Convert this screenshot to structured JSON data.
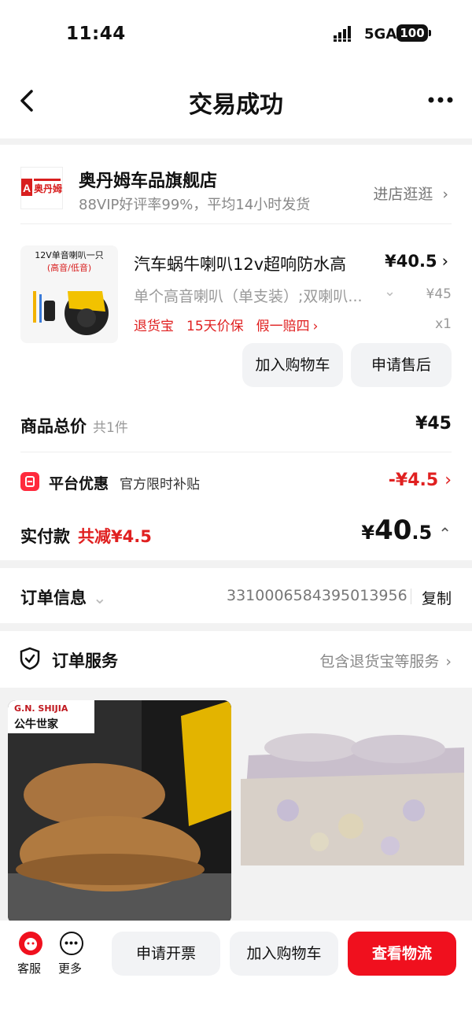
{
  "status": {
    "time": "11:44",
    "network": "5GA",
    "battery": "100"
  },
  "nav": {
    "title": "交易成功"
  },
  "shop": {
    "name": "奥丹姆车品旗舰店",
    "subtitle": "88VIP好评率99%，平均14小时发货",
    "enter_label": "进店逛逛",
    "logo_text": "奥丹姆"
  },
  "product": {
    "image_text_1": "12V单音喇叭一只",
    "image_text_2": "(高音/低音)",
    "title": "汽车蜗牛喇叭12v超响防水高",
    "price": "¥40.5",
    "spec": "单个高音喇叭（单支装）;双喇叭...",
    "original_price": "¥45",
    "tags": [
      "退货宝",
      "15天价保",
      "假一赔四"
    ],
    "quantity": "x1",
    "add_cart_label": "加入购物车",
    "after_sale_label": "申请售后"
  },
  "summary": {
    "total_label": "商品总价",
    "total_count": "共1件",
    "total_value": "¥45",
    "discount_label": "平台优惠",
    "discount_sub": "官方限时补贴",
    "discount_value": "-¥4.5",
    "paid_label": "实付款",
    "paid_reduce": "共减¥4.5",
    "paid_currency": "¥",
    "paid_int": "40",
    "paid_dec": ".5"
  },
  "order_info": {
    "label": "订单信息",
    "number": "3310006584395013956",
    "copy_label": "复制"
  },
  "order_service": {
    "label": "订单服务",
    "right_label": "包含退货宝等服务"
  },
  "recommend": {
    "brand_left": "G.N. SHIJIA",
    "brand_left_cn": "公牛世家"
  },
  "bottom": {
    "service_label": "客服",
    "more_label": "更多",
    "invoice_label": "申请开票",
    "cart_label": "加入购物车",
    "logistics_label": "查看物流"
  },
  "colors": {
    "accent_red": "#e02020",
    "primary_button": "#f0101e"
  }
}
